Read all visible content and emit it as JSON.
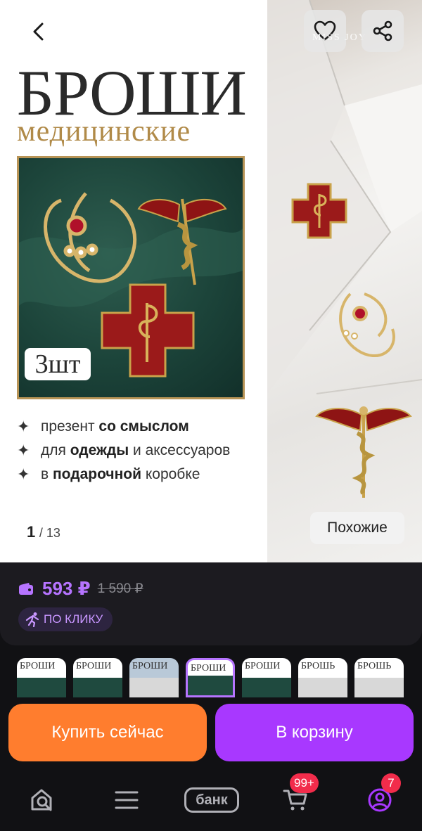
{
  "hero": {
    "title": "БРОШИ",
    "subtitle": "медицинские",
    "quantity_badge": "3шт",
    "brand_watermark": "MISS JOY",
    "bullets": [
      {
        "pre": "презент ",
        "bold": "со смыслом",
        "post": ""
      },
      {
        "pre": "для ",
        "bold": "одежды",
        "post": " и аксессуаров"
      },
      {
        "pre": "в ",
        "bold": "подарочной",
        "post": " коробке"
      }
    ],
    "counter_current": "1",
    "counter_total": "/ 13",
    "similar_label": "Похожие"
  },
  "price": {
    "current": "593 ₽",
    "old": "1 590 ₽",
    "promo": "ПО КЛИКУ",
    "accent_color": "#b674ff"
  },
  "thumbnails": [
    {
      "label": "БРОШИ",
      "style": "green"
    },
    {
      "label": "БРОШИ",
      "style": "green"
    },
    {
      "label": "БРОШИ",
      "style": "grey"
    },
    {
      "label": "БРОШИ",
      "style": "green",
      "active": true
    },
    {
      "label": "БРОШИ",
      "style": "green"
    },
    {
      "label": "БРОШЬ",
      "style": "grey"
    },
    {
      "label": "БРОШЬ",
      "style": "grey"
    }
  ],
  "actions": {
    "buy_now": "Купить сейчас",
    "buy_now_color": "#ff7d2e",
    "add_to_cart": "В корзину",
    "add_to_cart_color": "#a838ff"
  },
  "nav": {
    "home_icon": "search-home-icon",
    "catalog_icon": "menu-icon",
    "bank_label": "банк",
    "cart_badge": "99+",
    "profile_badge": "7"
  }
}
